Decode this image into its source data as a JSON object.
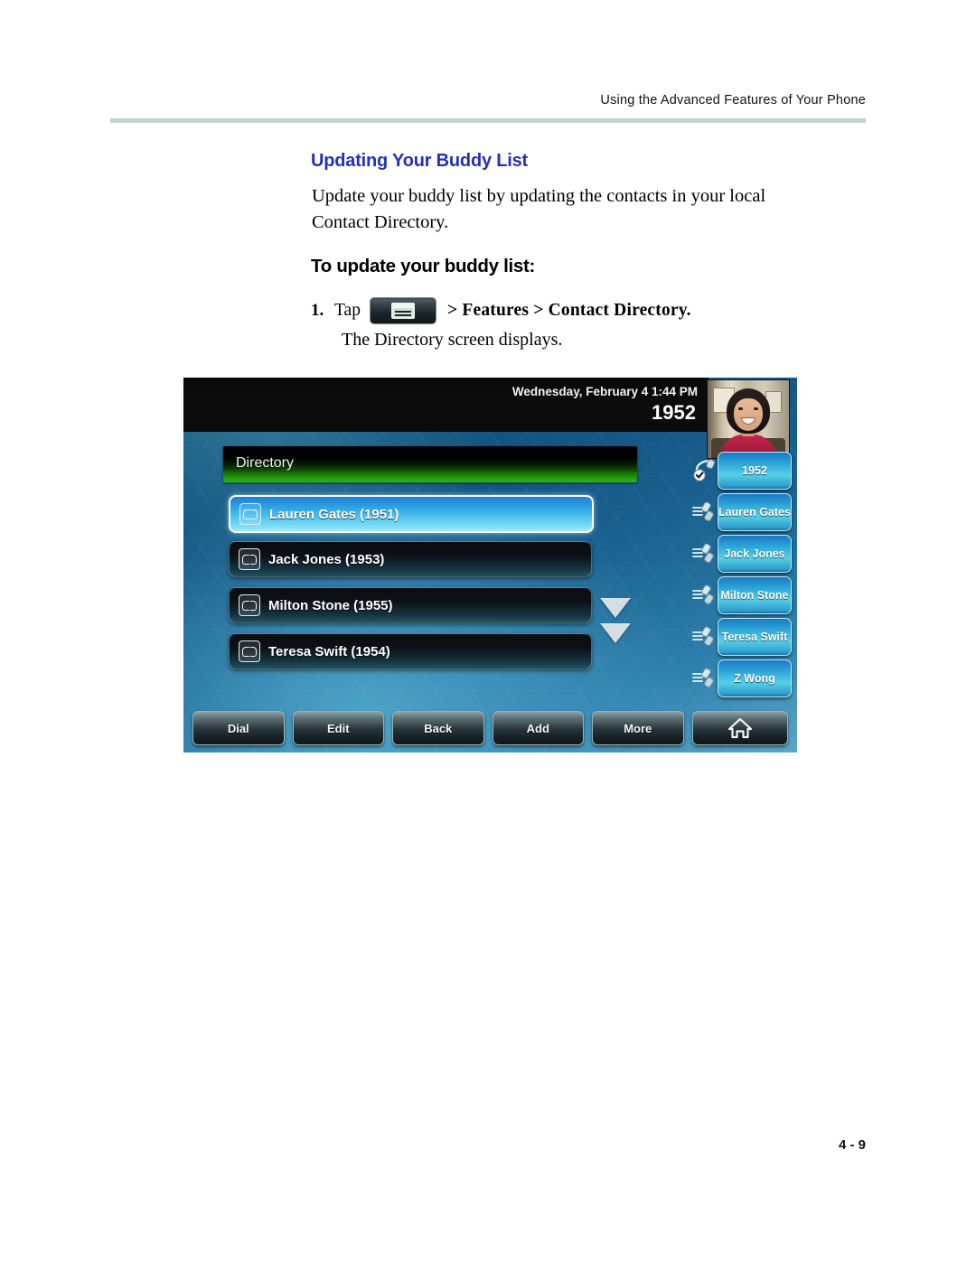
{
  "document": {
    "running_header": "Using the Advanced Features of Your Phone",
    "folio": "4 - 9"
  },
  "section": {
    "heading": "Updating Your Buddy List",
    "intro": "Update your buddy list by updating the contacts in your local Contact Directory.",
    "subheading": "To update your buddy list:",
    "step": {
      "number": "1.",
      "tap_label": "Tap",
      "button_icon": "home-menu-icon",
      "path_text": "> Features > Contact Directory.",
      "result_text": "The Directory screen displays."
    }
  },
  "phone_screen": {
    "status": {
      "datetime": "Wednesday, February 4  1:44 PM",
      "extension": "1952"
    },
    "avatar_alt": "user-photo",
    "title_bar": "Directory",
    "contacts": [
      {
        "label": "Lauren Gates (1951)",
        "icon": "contact-book-icon",
        "selected": true
      },
      {
        "label": "Jack Jones (1953)",
        "icon": "contact-book-icon",
        "selected": false
      },
      {
        "label": "Milton Stone (1955)",
        "icon": "contact-book-icon",
        "selected": false
      },
      {
        "label": "Teresa Swift (1954)",
        "icon": "contact-book-icon",
        "selected": false
      }
    ],
    "scroll_arrows": [
      "scroll-down-arrow",
      "scroll-down-double-arrow"
    ],
    "line_keys": [
      {
        "label": "1952",
        "icon": "handset-registered-icon"
      },
      {
        "label": "Lauren Gates",
        "icon": "handset-idle-icon"
      },
      {
        "label": "Jack Jones",
        "icon": "handset-idle-icon"
      },
      {
        "label": "Milton Stone",
        "icon": "handset-idle-icon"
      },
      {
        "label": "Teresa Swift",
        "icon": "handset-idle-icon"
      },
      {
        "label": "Z Wong",
        "icon": "handset-idle-icon"
      }
    ],
    "soft_keys": [
      {
        "label": "Dial",
        "icon": ""
      },
      {
        "label": "Edit",
        "icon": ""
      },
      {
        "label": "Back",
        "icon": ""
      },
      {
        "label": "Add",
        "icon": ""
      },
      {
        "label": "More",
        "icon": ""
      },
      {
        "label": "",
        "icon": "home-icon"
      }
    ]
  },
  "colors": {
    "heading_blue": "#2330b8",
    "rule_gray": "#c3d2cc",
    "title_bar_green": "#2bb80e",
    "selected_row_blue": "#2ea2e3"
  }
}
